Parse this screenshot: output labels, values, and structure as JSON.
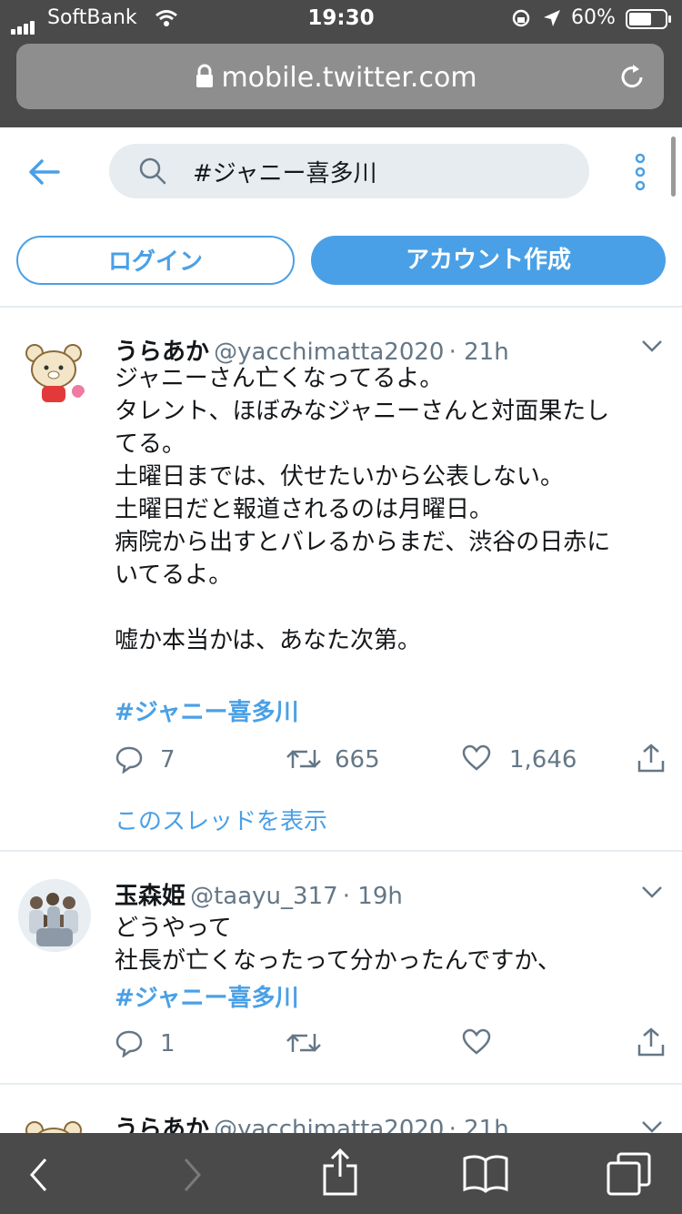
{
  "status_bar": {
    "carrier": "SoftBank",
    "time": "19:30",
    "battery": "60%"
  },
  "browser": {
    "url": "mobile.twitter.com"
  },
  "header": {
    "search_query": "#ジャニー喜多川",
    "login_label": "ログイン",
    "signup_label": "アカウント作成"
  },
  "tweets": [
    {
      "name": "うらあか",
      "handle": "@yacchimatta2020",
      "time": "· 21h",
      "body": "ジャニーさん亡くなってるよ。\nタレント、ほぼみなジャニーさんと対面果たし\nてる。\n土曜日までは、伏せたいから公表しない。\n土曜日だと報道されるのは月曜日。\n病院から出すとバレるからまだ、渋谷の日赤に\nいてるよ。\n\n嘘か本当かは、あなた次第。",
      "hashtag": "#ジャニー喜多川",
      "replies": "7",
      "retweets": "665",
      "likes": "1,646",
      "thread_link": "このスレッドを表示"
    },
    {
      "name": "玉森姫",
      "handle": "@taayu_317",
      "time": "· 19h",
      "body": "どうやって\n社長が亡くなったって分かったんですか、",
      "hashtag": "#ジャニー喜多川",
      "replies": "1"
    },
    {
      "name": "うらあか",
      "handle": "@yacchimatta2020",
      "time": "· 21h"
    }
  ],
  "colors": {
    "accent": "#4aa0e6",
    "chrome": "#4a4a4a",
    "secondary_text": "#657786"
  }
}
